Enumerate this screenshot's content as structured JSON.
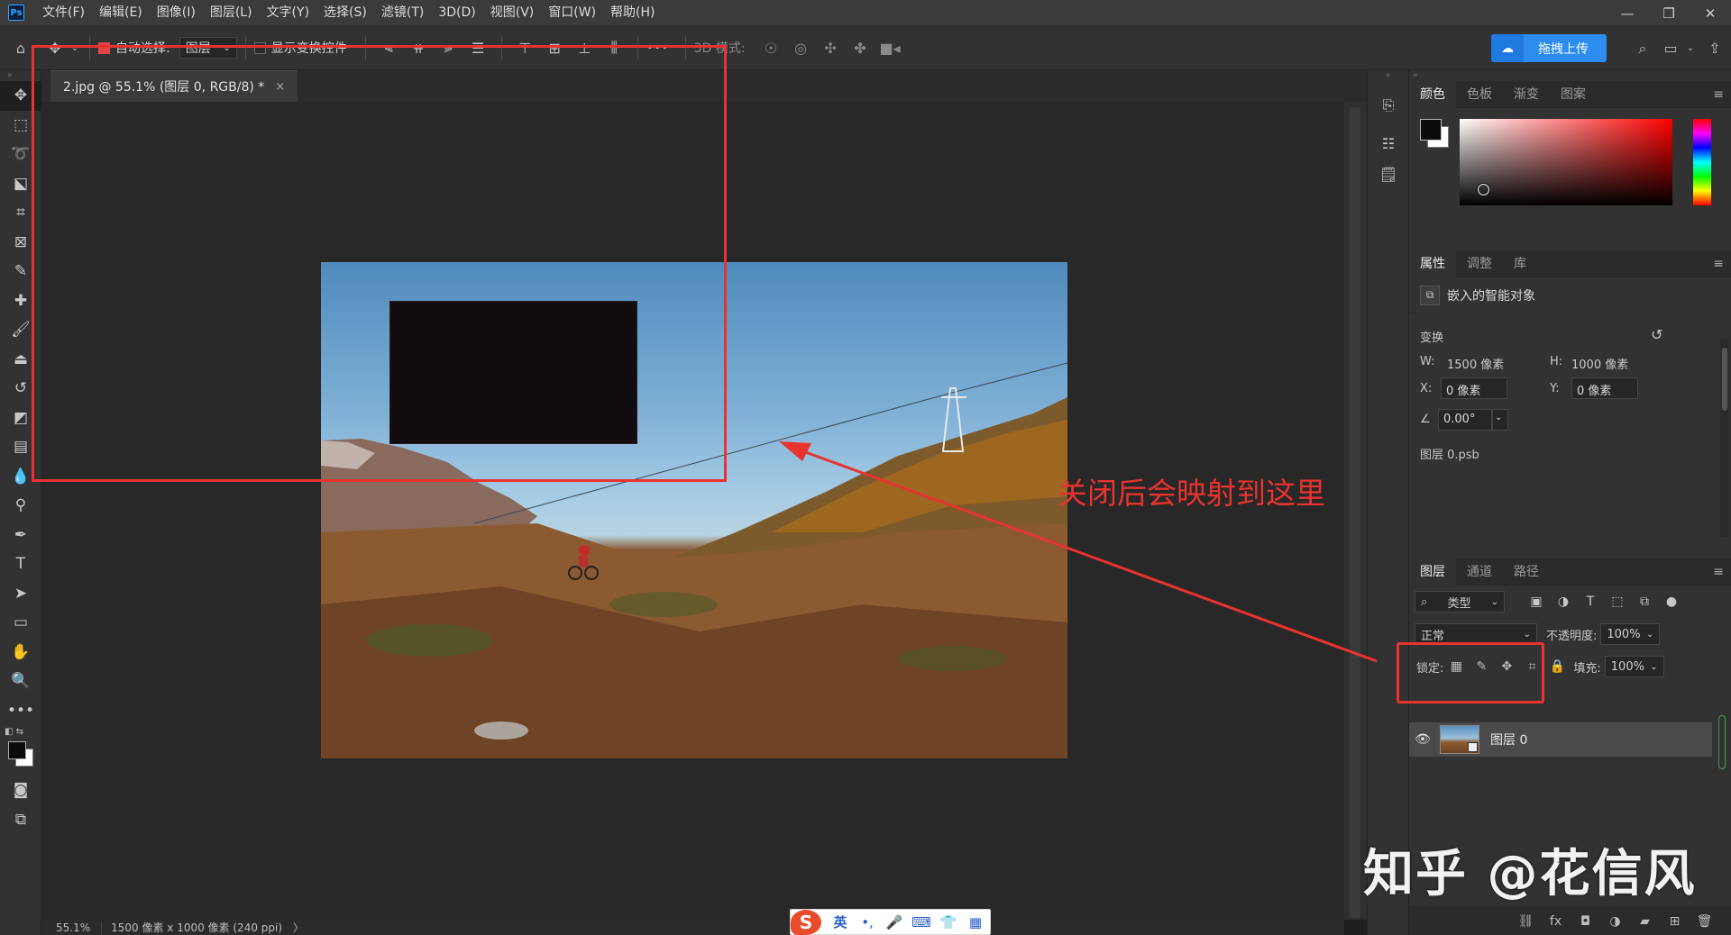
{
  "app": {
    "logo_text": "Ps"
  },
  "menu": {
    "items": [
      "文件(F)",
      "编辑(E)",
      "图像(I)",
      "图层(L)",
      "文字(Y)",
      "选择(S)",
      "滤镜(T)",
      "3D(D)",
      "视图(V)",
      "窗口(W)",
      "帮助(H)"
    ]
  },
  "options_bar": {
    "auto_select_label": "自动选择:",
    "auto_select_value": "图层",
    "show_transform_label": "显示变换控件",
    "mode_3d_label": "3D 模式:",
    "more_label": "•••",
    "upload_button": "拖拽上传"
  },
  "document": {
    "tab_title": "2.jpg @ 55.1% (图层 0, RGB/8) *",
    "tab_close": "×"
  },
  "status_bar": {
    "zoom": "55.1%",
    "doc_size": "1500 像素 x 1000 像素 (240 ppi)",
    "arrow": "〉"
  },
  "annotation": {
    "text": "关闭后会映射到这里",
    "color": "#e8332f"
  },
  "panels": {
    "color_tabs": [
      "颜色",
      "色板",
      "渐变",
      "图案"
    ],
    "props_tabs": [
      "属性",
      "调整",
      "库"
    ],
    "props_object_type": "嵌入的智能对象",
    "transform_label": "变换",
    "w_label": "W:",
    "w_value": "1500 像素",
    "h_label": "H:",
    "h_value": "1000 像素",
    "x_label": "X:",
    "x_value": "0 像素",
    "y_label": "Y:",
    "y_value": "0 像素",
    "angle_value": "0.00°",
    "linked_file": "图层 0.psb",
    "layers_tabs": [
      "图层",
      "通道",
      "路径"
    ],
    "filter_kind": "类型",
    "blend_mode": "正常",
    "opacity_label": "不透明度:",
    "opacity_value": "100%",
    "lock_label": "锁定:",
    "fill_label": "填充:",
    "fill_value": "100%",
    "layer_name": "图层 0"
  },
  "ime": {
    "logo": "S",
    "lang": "英",
    "punct": "•,"
  },
  "watermark": "知乎 @花信风"
}
